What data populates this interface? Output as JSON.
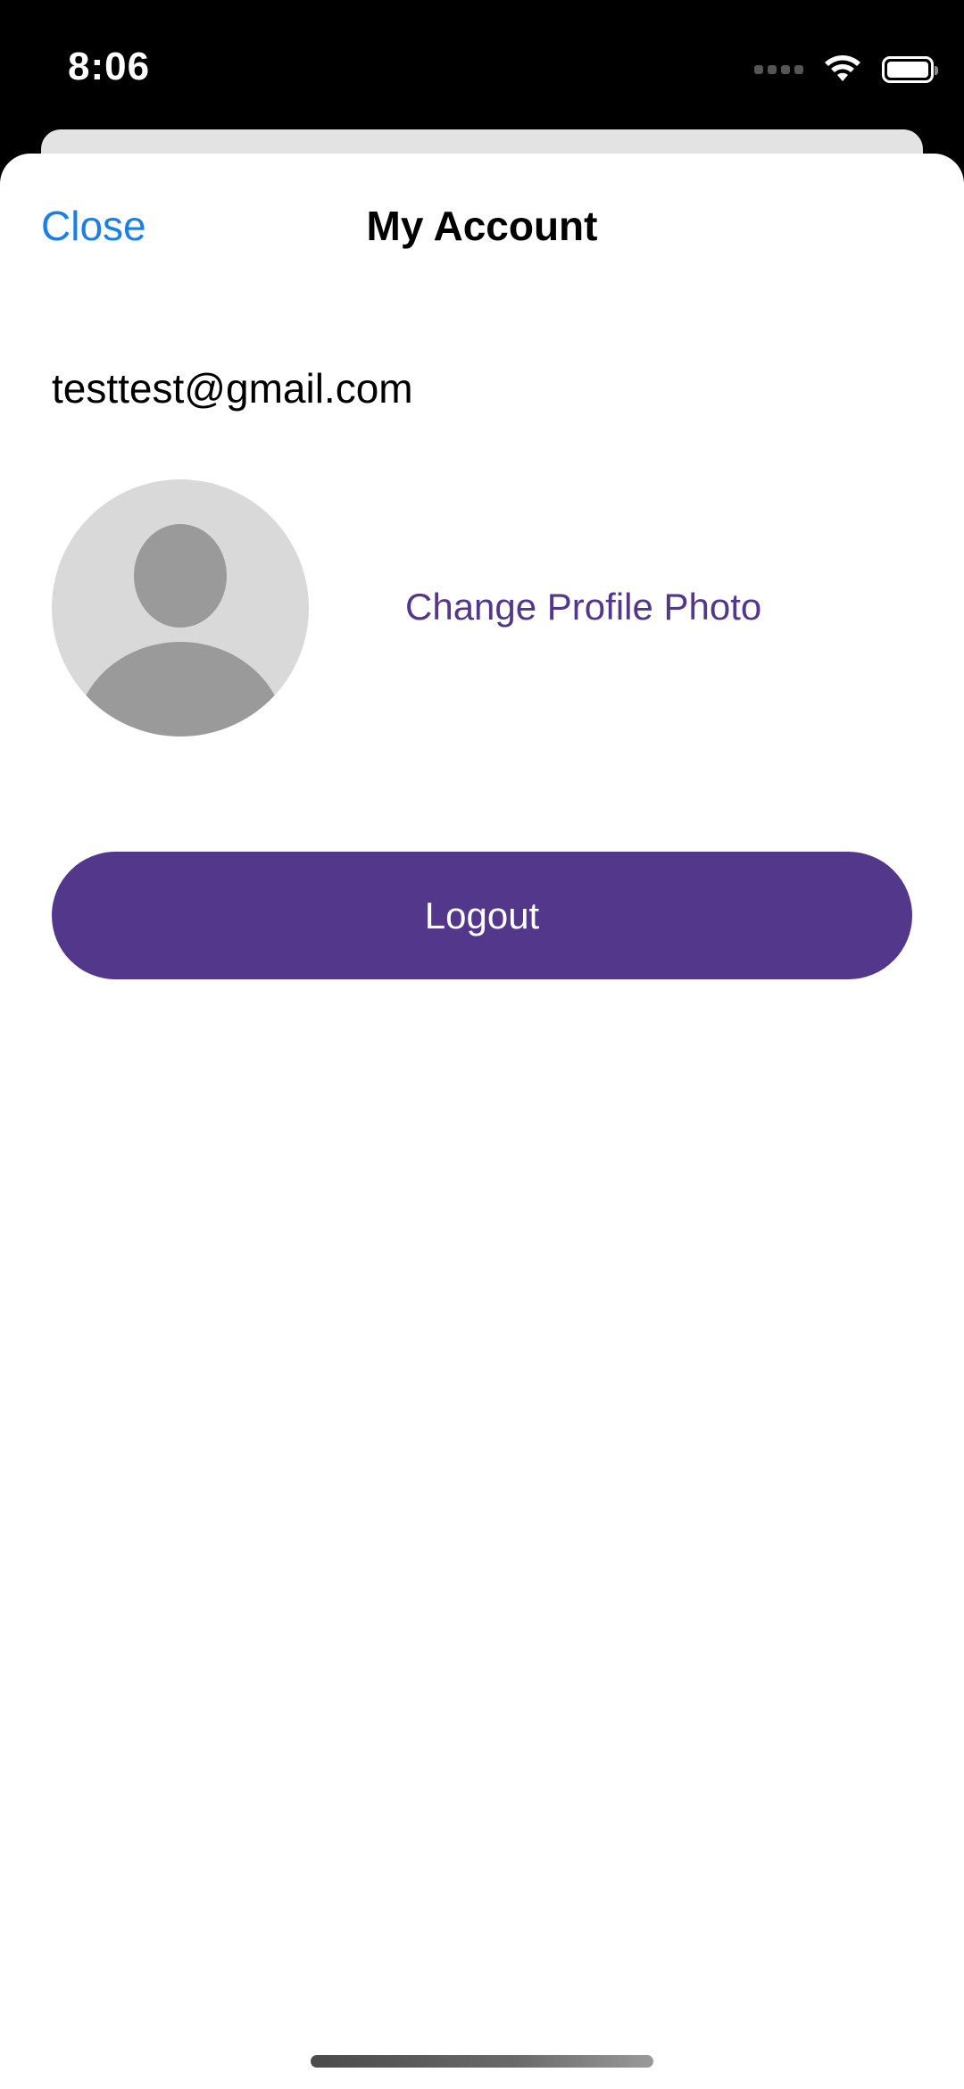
{
  "status_bar": {
    "time": "8:06",
    "icons": [
      "cellular-signal-icon",
      "wifi-icon",
      "battery-icon"
    ],
    "battery_level": 1.0
  },
  "nav": {
    "close_label": "Close",
    "title": "My Account"
  },
  "account": {
    "email": "testtest@gmail.com",
    "avatar_icon": "default-avatar-icon",
    "change_photo_label": "Change Profile Photo"
  },
  "actions": {
    "logout_label": "Logout"
  },
  "colors": {
    "accent": "#52378a",
    "link_blue": "#1a7fe6",
    "avatar_bg": "#d9d9d9",
    "avatar_fg": "#9a9a9a"
  }
}
